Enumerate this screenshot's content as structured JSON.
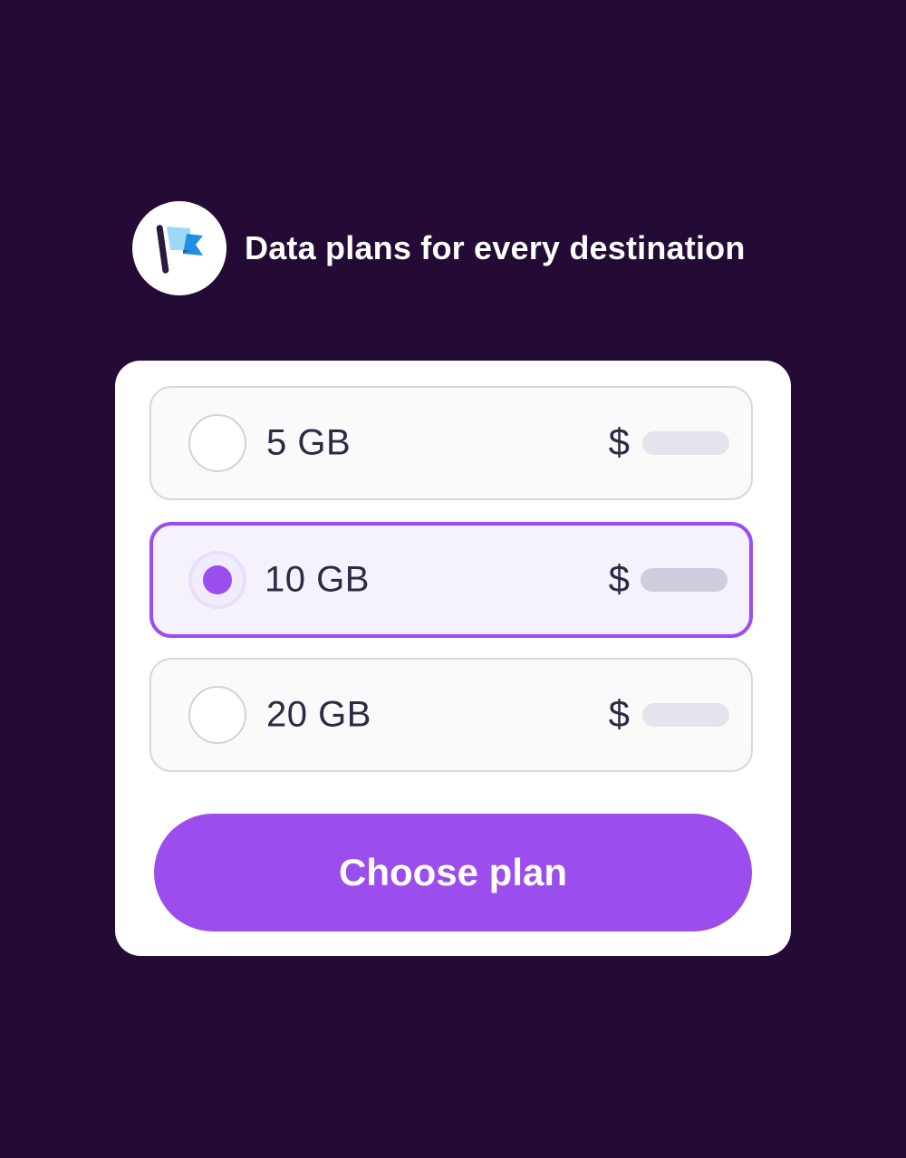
{
  "header": {
    "icon": "flag-icon",
    "title": "Data plans for every destination"
  },
  "plans": [
    {
      "label": "5 GB",
      "currency": "$",
      "selected": false
    },
    {
      "label": "10 GB",
      "currency": "$",
      "selected": true
    },
    {
      "label": "20 GB",
      "currency": "$",
      "selected": false
    }
  ],
  "action": {
    "choose_label": "Choose plan"
  },
  "colors": {
    "background": "#240b36",
    "accent": "#9b4ded",
    "card": "#ffffff",
    "text": "#2c2a44"
  }
}
